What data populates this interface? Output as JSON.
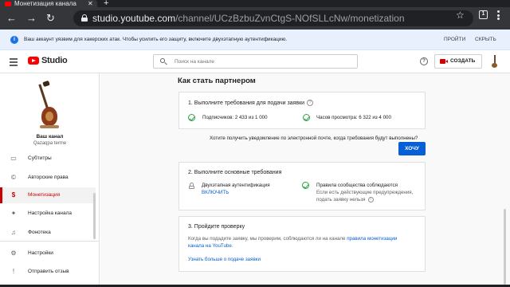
{
  "browser": {
    "tab_title": "Монетизация канала",
    "tab_close": "✕",
    "new_tab": "+",
    "back": "←",
    "forward": "→",
    "reload": "↻",
    "url_host": "studio.youtube.com",
    "url_path": "/channel/UCzBzbuZvnCtgS-NOfSLLcNw/monetization",
    "star": "☆",
    "tab_count": "1"
  },
  "banner": {
    "info": "i",
    "text": "Ваш аккаунт уязвим для хакерских атак. Чтобы усилить его защиту, включите двухэтапную аутентификацию.",
    "try_label": "ПРОЙТИ",
    "hide_label": "СКРЫТЬ"
  },
  "header": {
    "logo_text": "Studio",
    "search_placeholder": "Поиск на канале",
    "help": "?",
    "create_label": "СОЗДАТЬ"
  },
  "sidebar": {
    "channel_name": "Ваш канал",
    "channel_handle": "Qazaqpa terme",
    "items": [
      {
        "icon": "▭",
        "label": "Субтитры"
      },
      {
        "icon": "©",
        "label": "Авторские права"
      },
      {
        "icon": "$",
        "label": "Монетизация"
      },
      {
        "icon": "✦",
        "label": "Настройка канала"
      },
      {
        "icon": "♫",
        "label": "Фонотека"
      },
      {
        "icon": "⚙",
        "label": "Настройки"
      },
      {
        "icon": "!",
        "label": "Отправить отзыв"
      }
    ]
  },
  "main": {
    "title": "Как стать партнером",
    "step1": {
      "title": "1. Выполните требования для подачи заявки",
      "help": "?",
      "subscribers": "Подписчиков: 2 433 из 1 000",
      "watch_hours": "Часов просмотра: 6 322 из 4 000"
    },
    "notify_text": "Хотите получить уведомление по электронной почте, когда требования будут выполнены?",
    "want_label": "ХОЧУ",
    "step2": {
      "title": "2. Выполните основные требования",
      "twofa_title": "Двухэтапная аутентификация",
      "twofa_link": "ВКЛЮЧИТЬ",
      "rules_title": "Правила сообщества соблюдаются",
      "rules_line1": "Если есть действующие предупреждения,",
      "rules_line2": "подать заявку нельзя",
      "info": "i"
    },
    "step3": {
      "title": "3. Пройдите проверку",
      "text_before_link": "Когда вы подадите заявку, мы проверим, соблюдаются ли на канале ",
      "link1_part1": "правила монетизации",
      "link1_part2": "канала на YouTube",
      "text_after_link": ".",
      "learn_more": "Узнать больше о подаче заявки"
    }
  },
  "colors": {
    "brand_red": "#ff0000",
    "active_red": "#cc0000",
    "link_blue": "#065fd4",
    "check_green": "#2ba640",
    "banner_bg": "#e8f0fe"
  }
}
